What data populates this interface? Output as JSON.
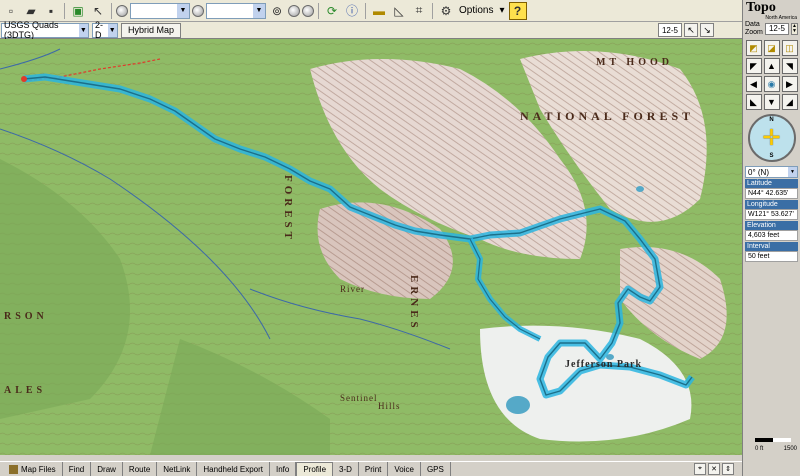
{
  "toolbar2": {
    "map_series": "USGS Quads (3DTG)",
    "view_mode": "2-D",
    "hybrid_map": "Hybrid Map",
    "zoom_level": "12-5"
  },
  "toolbar": {
    "options_label": "Options"
  },
  "panel": {
    "brand_title": "Topo",
    "brand_sub": "North America",
    "data_zoom_label_1": "Data",
    "data_zoom_label_2": "Zoom",
    "data_zoom_value": "12-5",
    "compass_n": "N",
    "compass_s": "S",
    "bearing": "0° (N)",
    "latitude_label": "Latitude",
    "latitude": "N44° 42.635'",
    "longitude_label": "Longitude",
    "longitude": "W121° 53.627'",
    "elevation_label": "Elevation",
    "elevation": "4,603 feet",
    "interval_label": "Interval",
    "interval": "50 feet",
    "scale_start": "0 ft",
    "scale_end": "1500"
  },
  "map": {
    "labels": {
      "forest_1": "NATIONAL  FOREST",
      "forest_2": "FOREST",
      "park": "Jefferson  Park",
      "mt_hood": "MT HOOD",
      "river": "River",
      "sentinel": "Sentinel",
      "hills": "Hills",
      "rson": "RSON",
      "wilderness": "ERNES",
      "ales": "ALES"
    }
  },
  "tabs": [
    {
      "label": "Map Files",
      "active": false
    },
    {
      "label": "Find",
      "active": false
    },
    {
      "label": "Draw",
      "active": false
    },
    {
      "label": "Route",
      "active": false
    },
    {
      "label": "NetLink",
      "active": false
    },
    {
      "label": "Handheld Export",
      "active": false
    },
    {
      "label": "Info",
      "active": false
    },
    {
      "label": "Profile",
      "active": true
    },
    {
      "label": "3-D",
      "active": false
    },
    {
      "label": "Print",
      "active": false
    },
    {
      "label": "Voice",
      "active": false
    },
    {
      "label": "GPS",
      "active": false
    }
  ]
}
